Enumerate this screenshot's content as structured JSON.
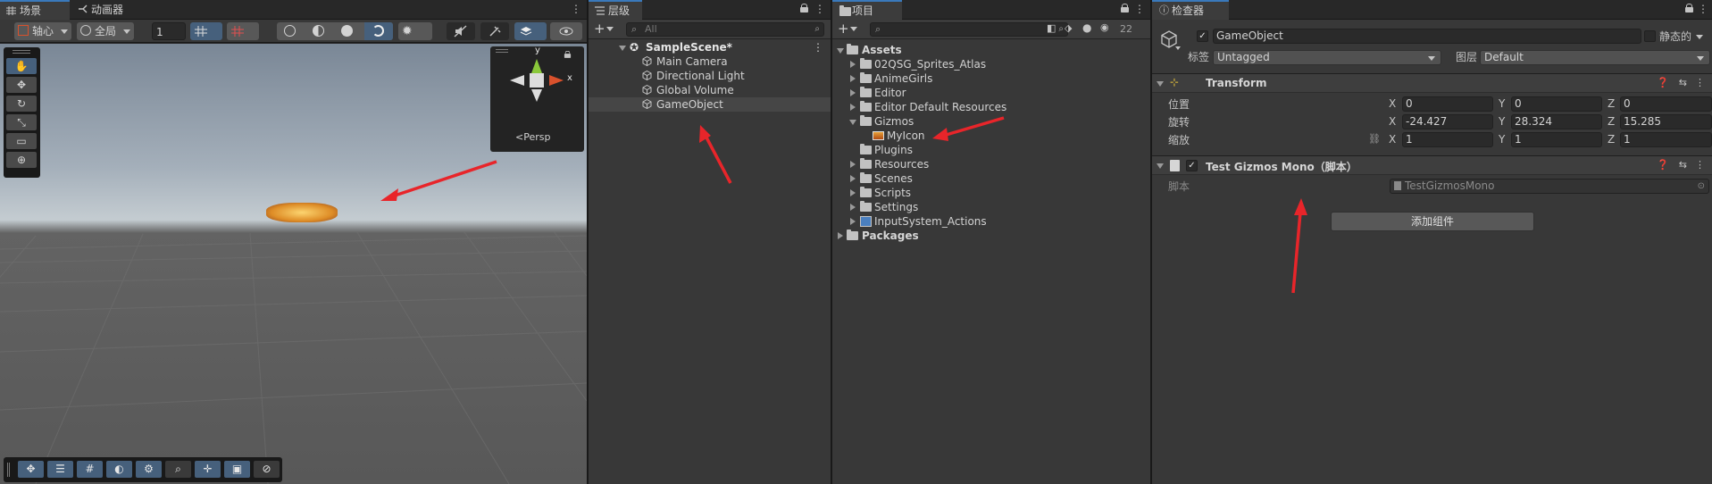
{
  "scene_panel": {
    "tabs": [
      {
        "label": "场景"
      },
      {
        "label": "动画器"
      }
    ],
    "toolbar": {
      "pivot_label": "轴心",
      "global_label": "全局",
      "snap_value": "1"
    },
    "gizmo": {
      "axis_y": "y",
      "axis_x": "x",
      "persp_label": "Persp"
    }
  },
  "hierarchy": {
    "tab_label": "层级",
    "search_placeholder": "All",
    "scene_name": "SampleScene*",
    "items": [
      {
        "label": "Main Camera"
      },
      {
        "label": "Directional Light"
      },
      {
        "label": "Global Volume"
      },
      {
        "label": "GameObject",
        "selected": true
      }
    ]
  },
  "project": {
    "tab_label": "项目",
    "hidden_count": "22",
    "tree": [
      {
        "label": "Assets",
        "expanded": true
      },
      {
        "label": "02QSG_Sprites_Atlas"
      },
      {
        "label": "AnimeGirls"
      },
      {
        "label": "Editor"
      },
      {
        "label": "Editor Default Resources"
      },
      {
        "label": "Gizmos",
        "expanded": true
      },
      {
        "label": "MyIcon"
      },
      {
        "label": "Plugins"
      },
      {
        "label": "Resources"
      },
      {
        "label": "Scenes"
      },
      {
        "label": "Scripts"
      },
      {
        "label": "Settings"
      },
      {
        "label": "InputSystem_Actions"
      },
      {
        "label": "Packages"
      }
    ]
  },
  "inspector": {
    "tab_label": "检查器",
    "object_name": "GameObject",
    "static_label": "静态的",
    "tag_label": "标签",
    "tag_value": "Untagged",
    "layer_label": "图层",
    "layer_value": "Default",
    "transform": {
      "title": "Transform",
      "position_label": "位置",
      "rotation_label": "旋转",
      "scale_label": "缩放",
      "position": {
        "x": "0",
        "y": "0",
        "z": "0"
      },
      "rotation": {
        "x": "-24.427",
        "y": "28.324",
        "z": "15.285"
      },
      "scale": {
        "x": "1",
        "y": "1",
        "z": "1"
      }
    },
    "script_component": {
      "title": "Test Gizmos Mono（脚本）",
      "script_label": "脚本",
      "script_value": "TestGizmosMono"
    },
    "add_component_label": "添加组件"
  },
  "axis_letters": {
    "x": "X",
    "y": "Y",
    "z": "Z"
  },
  "colors": {
    "accent_blue": "#3a79bb",
    "selection": "#46607c",
    "annotation_red": "#e8252a",
    "panel_bg": "#383838"
  }
}
